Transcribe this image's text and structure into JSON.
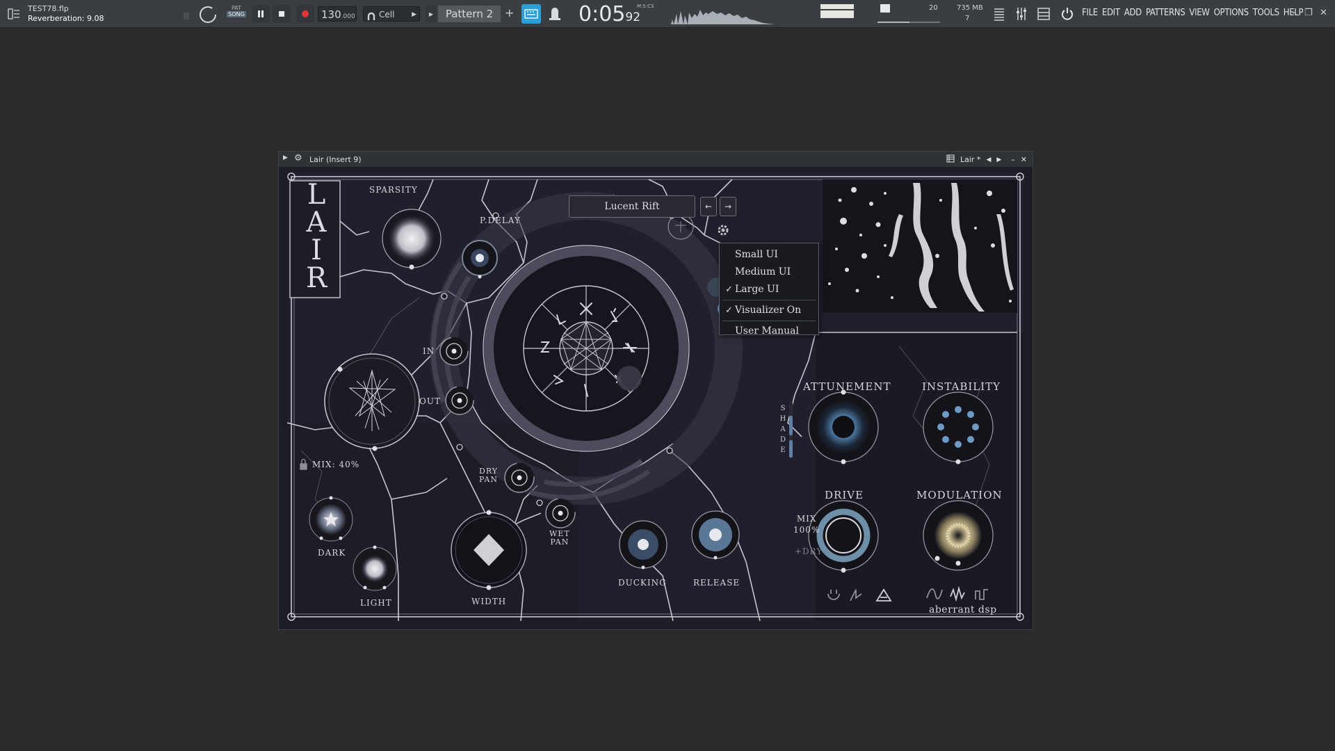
{
  "toolbar": {
    "file_name": "TEST78.flp",
    "hint_text": "Reverberation: 9.08",
    "pat_label": "PAT",
    "song_label": "SONG",
    "tempo": "130",
    "tempo_decimal": ".000",
    "snap_label": "Cell",
    "pattern_label": "Pattern 2",
    "pattern_add": "+",
    "time_main": "0:05",
    "time_cs": "92",
    "time_label": "M:S:CS",
    "cpu_value": "20",
    "memory": "735 MB",
    "voices": "7",
    "menu": [
      "FILE",
      "EDIT",
      "ADD",
      "PATTERNS",
      "VIEW",
      "OPTIONS",
      "TOOLS",
      "HELP"
    ],
    "minimize": "–",
    "restore": "❐",
    "close": "✕"
  },
  "plugin_window": {
    "title": "Lair (Insert 9)",
    "preset_short": "Lair *",
    "prev": "◀",
    "next": "▶",
    "minimize": "–",
    "close": "✕"
  },
  "lair": {
    "logo_letters": [
      "L",
      "A",
      "I",
      "R"
    ],
    "preset_name": "Lucent Rift",
    "preset_prev": "←",
    "preset_next": "→",
    "labels": {
      "sparsity": "SPARSITY",
      "pdelay": "P.DELAY",
      "in": "IN",
      "out": "OUT",
      "mix": "MIX: 40%",
      "dry_pan": "DRY\nPAN",
      "wet_pan": "WET\nPAN",
      "dark": "DARK",
      "light": "LIGHT",
      "width": "WIDTH",
      "ducking": "DUCKING",
      "release": "RELEASE",
      "attunement": "ATTUNEMENT",
      "instability": "INSTABILITY",
      "drive": "DRIVE",
      "modulation": "MODULATION",
      "drive_mix": "MIX\n100%",
      "plus_dry": "+DRY",
      "shade_letters": [
        "S",
        "H",
        "A",
        "D",
        "E"
      ],
      "brand": "aberrant dsp"
    },
    "context_menu": [
      {
        "label": "Small UI",
        "checked": false
      },
      {
        "label": "Medium UI",
        "checked": false
      },
      {
        "label": "Large UI",
        "checked": true
      },
      {
        "label": "Visualizer On",
        "checked": true
      },
      {
        "label": "User Manual",
        "checked": false
      }
    ],
    "check_glyph": "✓"
  },
  "colors": {
    "app_bg": "#2b2b2b",
    "toolbar_bg": "#3a3e42",
    "panel_bg": "#221f2c",
    "line": "#c9c9d2",
    "accent_blue": "#2a9fd6",
    "record_red": "#e0343a"
  }
}
